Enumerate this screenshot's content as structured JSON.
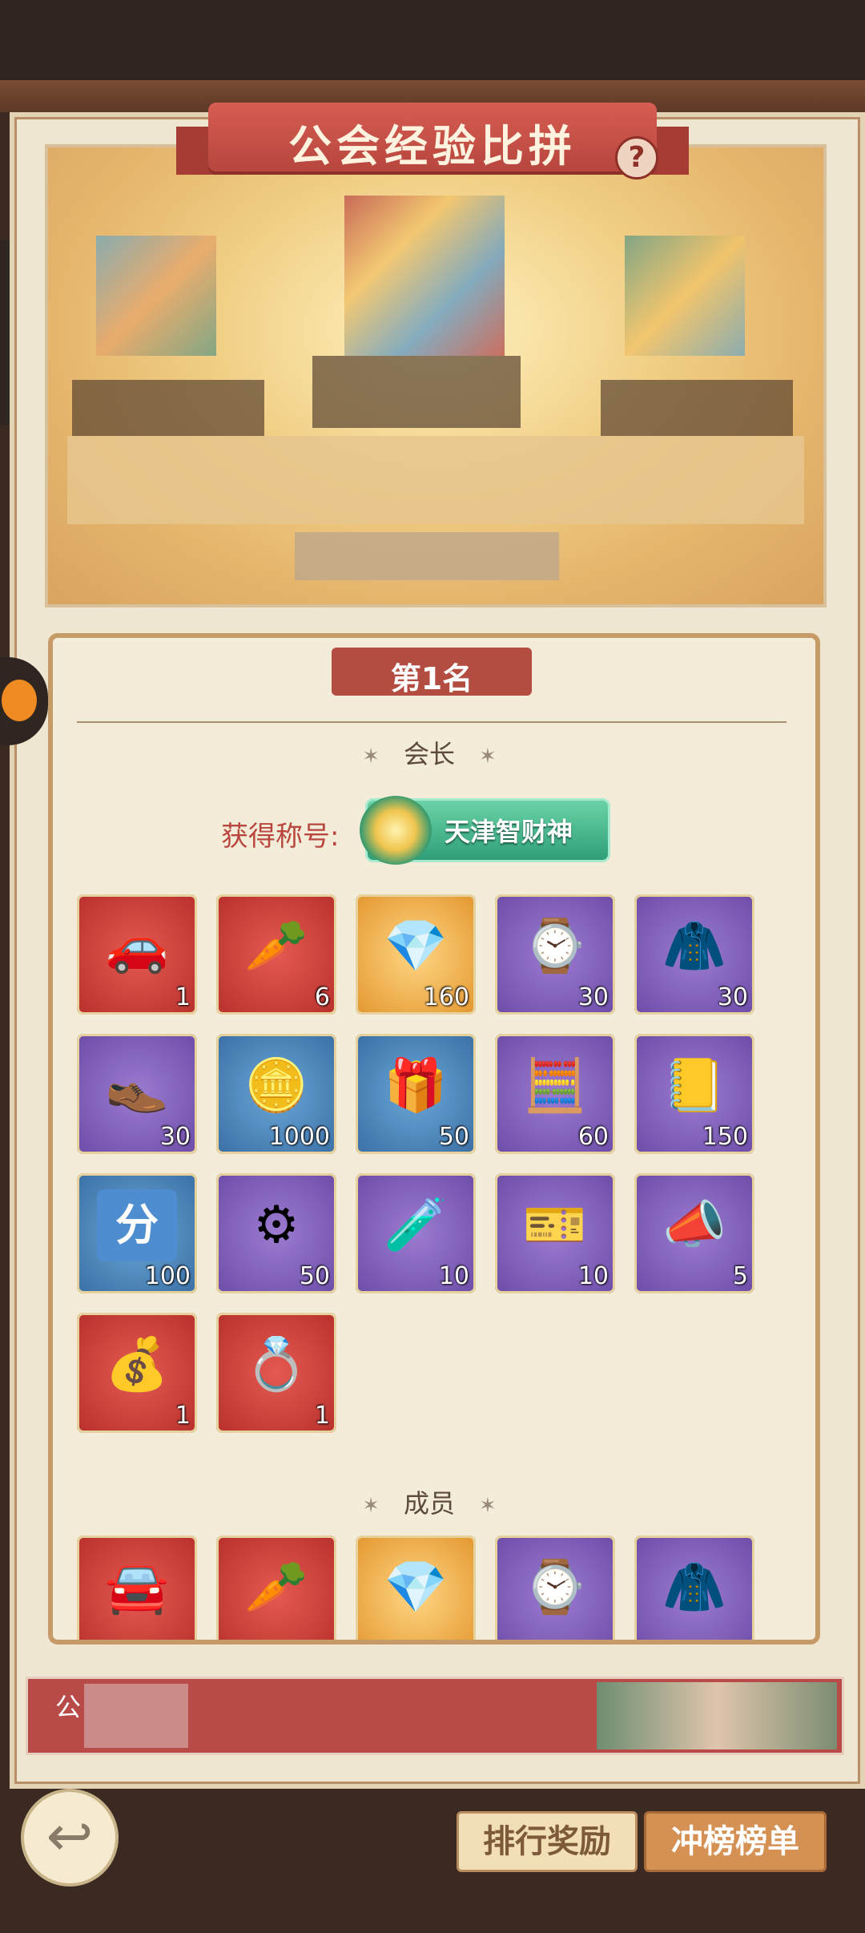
{
  "header": {
    "title": "公会经验比拼",
    "help_icon": "?"
  },
  "rank_card": {
    "rank_label": "第1名",
    "leader_section": "会长",
    "title_label": "获得称号:",
    "title_name": "天津智财神",
    "leader_rewards": [
      {
        "icon": "car-icon",
        "glyph": "🚗",
        "bg": "red",
        "count": "1"
      },
      {
        "icon": "ginseng-icon",
        "glyph": "🥕",
        "bg": "red",
        "count": "6"
      },
      {
        "icon": "pocket-watch-icon",
        "glyph": "💎",
        "bg": "gold",
        "count": "160"
      },
      {
        "icon": "wristwatch-icon",
        "glyph": "⌚",
        "bg": "purple",
        "count": "30"
      },
      {
        "icon": "suit-icon",
        "glyph": "🧥",
        "bg": "purple",
        "count": "30"
      },
      {
        "icon": "shoes-icon",
        "glyph": "👞",
        "bg": "purple",
        "count": "30"
      },
      {
        "icon": "gold-coin-icon",
        "glyph": "🪙",
        "bg": "blue",
        "count": "1000"
      },
      {
        "icon": "gift-box-icon",
        "glyph": "🎁",
        "bg": "blue",
        "count": "50"
      },
      {
        "icon": "calculator-icon",
        "glyph": "🧮",
        "bg": "purple",
        "count": "60"
      },
      {
        "icon": "question-book-icon",
        "glyph": "📒",
        "bg": "purple",
        "count": "150"
      },
      {
        "icon": "score-card-icon",
        "glyph": "分",
        "bg": "blue",
        "count": "100"
      },
      {
        "icon": "gear-icon",
        "glyph": "⚙",
        "bg": "purple",
        "count": "50"
      },
      {
        "icon": "potion-bottle-icon",
        "glyph": "🧪",
        "bg": "purple",
        "count": "10"
      },
      {
        "icon": "ticket-icon",
        "glyph": "🎫",
        "bg": "purple",
        "count": "10"
      },
      {
        "icon": "megaphone-icon",
        "glyph": "📣",
        "bg": "purple",
        "count": "5"
      },
      {
        "icon": "treasure-badge-icon",
        "glyph": "💰",
        "bg": "red",
        "count": "1"
      },
      {
        "icon": "wreath-frame-icon",
        "glyph": "💍",
        "bg": "red",
        "count": "1"
      }
    ],
    "member_section": "成员",
    "member_rewards": [
      {
        "icon": "car-icon",
        "glyph": "🚘",
        "bg": "red"
      },
      {
        "icon": "ginseng-icon",
        "glyph": "🥕",
        "bg": "red"
      },
      {
        "icon": "pocket-watch-icon",
        "glyph": "💎",
        "bg": "gold"
      },
      {
        "icon": "wristwatch-icon",
        "glyph": "⌚",
        "bg": "purple"
      },
      {
        "icon": "suit-icon",
        "glyph": "🧥",
        "bg": "purple"
      }
    ]
  },
  "bottom_strip": {
    "label": "公"
  },
  "buttons": {
    "rank_reward": "排行奖励",
    "leaderboard": "冲榜榜单"
  },
  "colors": {
    "accent_red": "#b84b48",
    "card_bg": "#f3ecd8"
  }
}
